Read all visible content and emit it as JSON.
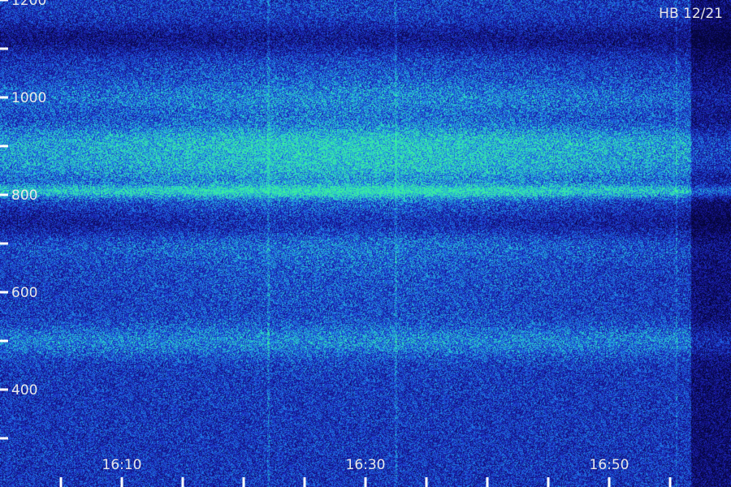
{
  "chart_data": {
    "type": "heatmap",
    "station_label": "HB 12/21",
    "y_ticks": [
      "1200",
      "1000",
      "800",
      "600",
      "400"
    ],
    "y_tick_values": [
      1200,
      1000,
      800,
      600,
      400
    ],
    "y_minor_values": [
      1100,
      900,
      700,
      500,
      300
    ],
    "ylim": [
      200,
      1200
    ],
    "x_ticks": [
      "16:10",
      "16:30",
      "16:50"
    ],
    "x_tick_minutes": [
      10,
      30,
      50
    ],
    "x_minor_minutes": [
      5,
      15,
      20,
      25,
      35,
      40,
      45,
      55
    ],
    "xlim_minutes": [
      0,
      60
    ],
    "colors": {
      "background": "#05053a",
      "low": "#1a1aa8",
      "mid": "#1e64e6",
      "high": "#28c8d2",
      "peak": "#3cf09c"
    },
    "bands": [
      {
        "freq": 1120,
        "intensity": -0.6
      },
      {
        "freq": 1000,
        "intensity": 0.35
      },
      {
        "freq": 910,
        "intensity": 0.7
      },
      {
        "freq": 860,
        "intensity": 0.6
      },
      {
        "freq": 808,
        "intensity": 1.0
      },
      {
        "freq": 740,
        "intensity": -0.5
      },
      {
        "freq": 700,
        "intensity": 0.2
      },
      {
        "freq": 500,
        "intensity": 0.55
      }
    ],
    "vertical_lines_minutes": [
      22,
      32.5,
      55.5
    ]
  }
}
